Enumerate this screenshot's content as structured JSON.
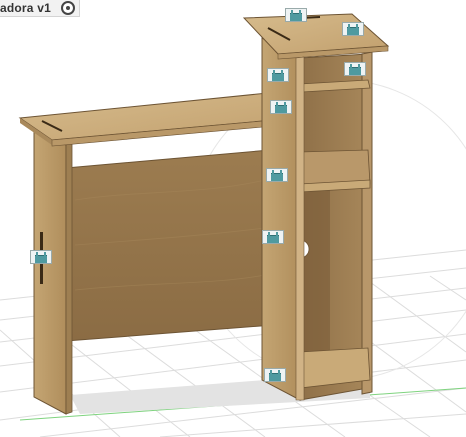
{
  "document": {
    "title": "adora v1",
    "visibility_icon": "radio-visible-icon"
  },
  "canvas": {
    "model": "desk-with-shelf-tower",
    "background_color": "#ffffff",
    "grid_color": "#dcdcdc",
    "wood_color": "#c7a676",
    "joint_icon": "joint-icon"
  }
}
